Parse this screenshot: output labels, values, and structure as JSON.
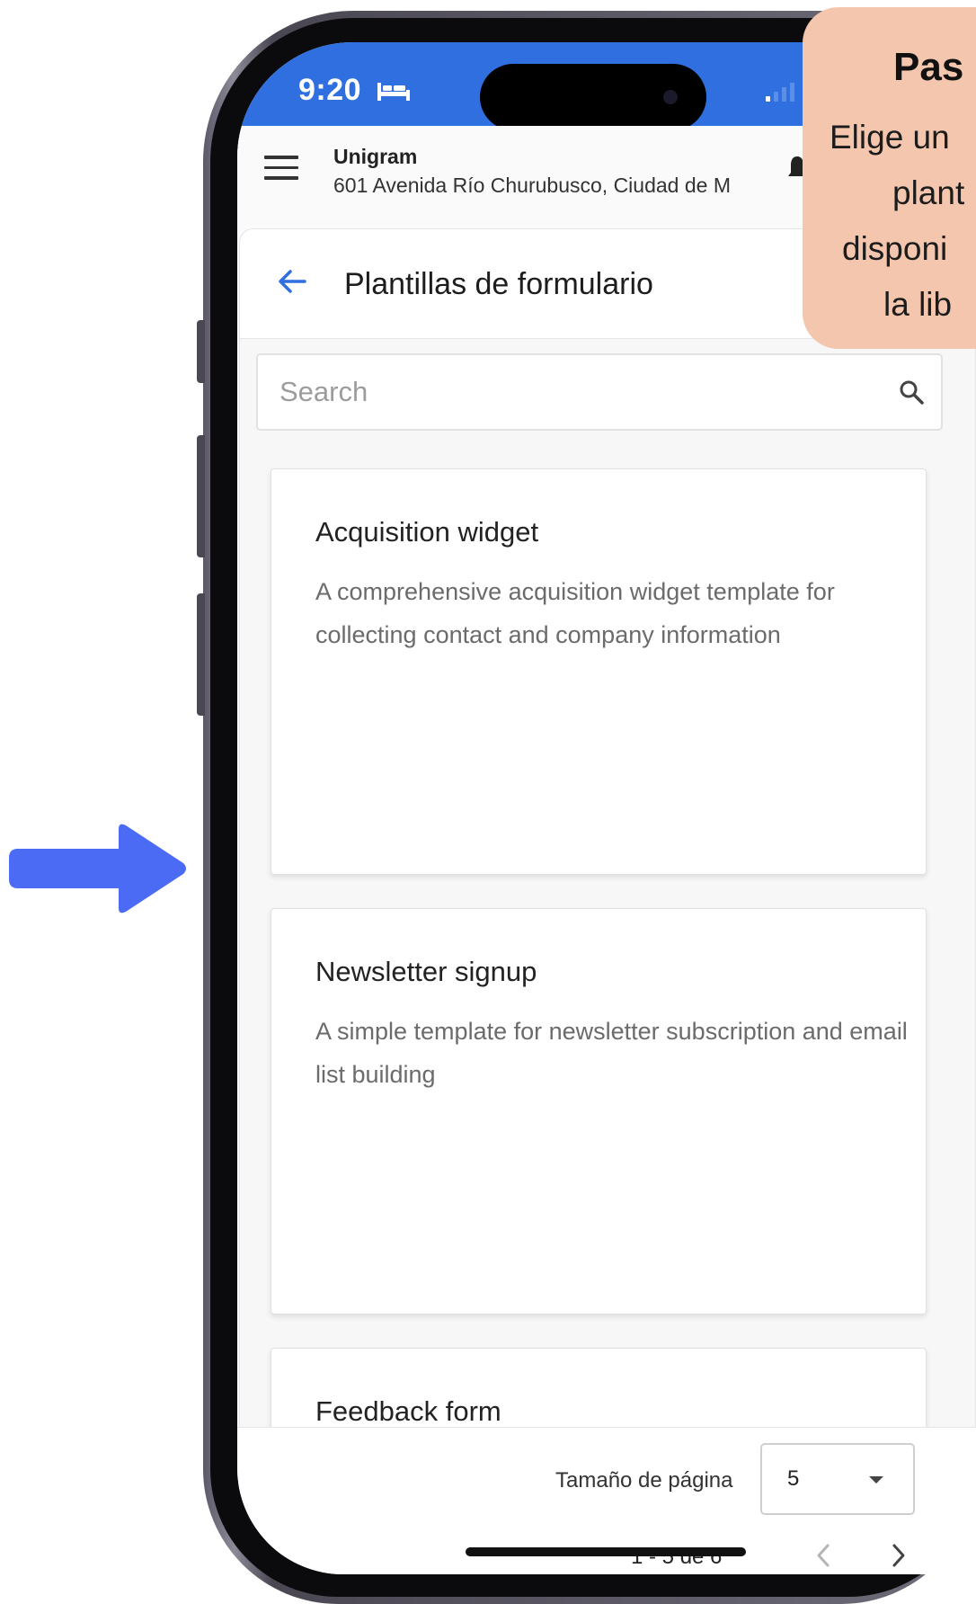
{
  "status_bar": {
    "time": "9:20",
    "bed_icon": "bed-icon",
    "signal_icon": "signal-icon"
  },
  "header": {
    "menu_icon": "hamburger-icon",
    "org_name": "Unigram",
    "org_address": "601 Avenida Río Churubusco, Ciudad de M",
    "notification_icon": "bell-icon"
  },
  "page": {
    "back_icon": "back-arrow-icon",
    "title": "Plantillas de formulario"
  },
  "search": {
    "placeholder": "Search",
    "value": "",
    "icon": "search-icon"
  },
  "templates": [
    {
      "title": "Acquisition widget",
      "description": "A comprehensive acquisition widget template for collecting contact and company information"
    },
    {
      "title": "Newsletter signup",
      "description": "A simple template for newsletter subscription and email list building"
    },
    {
      "title": "Feedback form",
      "description": ""
    }
  ],
  "pagination": {
    "page_size_label": "Tamaño de página",
    "page_size_value": "5",
    "range_text": "1 - 5 de 6",
    "prev_icon": "chevron-left-icon",
    "next_icon": "chevron-right-icon"
  },
  "step_bubble": {
    "title": "Pas",
    "lines": [
      "Elige un",
      "plant",
      "disponi",
      "la lib"
    ]
  },
  "colors": {
    "status_bar": "#2f6fdf",
    "accent": "#2f6fdf",
    "bubble": "#f4c6ad",
    "pointer_arrow": "#4b6bf5"
  },
  "pointer_icon": "arrow-right-icon"
}
